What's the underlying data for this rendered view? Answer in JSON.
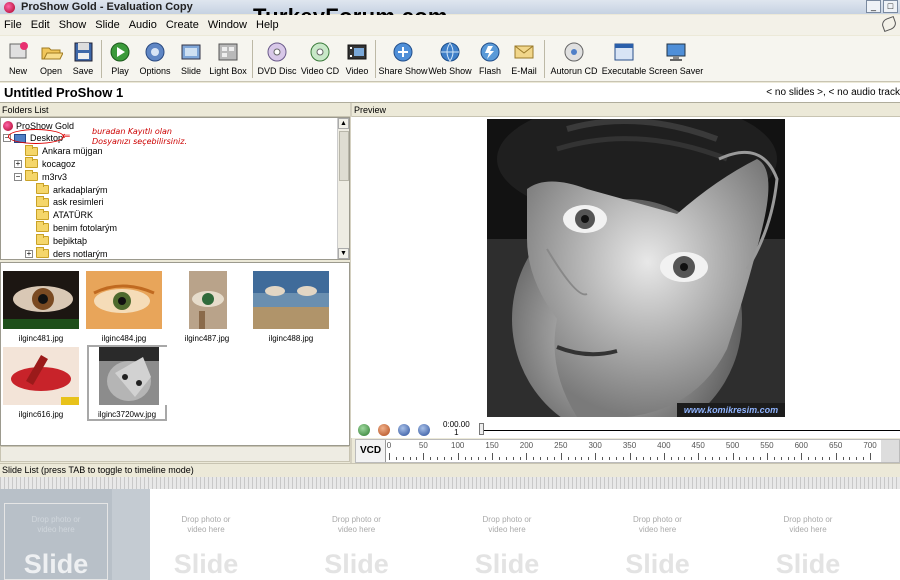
{
  "window": {
    "title": "ProShow Gold - Evaluation Copy",
    "min": "_",
    "max": "□"
  },
  "watermark": "TurkeyForum.com",
  "menu": [
    "File",
    "Edit",
    "Show",
    "Slide",
    "Audio",
    "Create",
    "Window",
    "Help"
  ],
  "toolbar": [
    {
      "label": "New",
      "icon": "new-icon"
    },
    {
      "label": "Open",
      "icon": "open-icon"
    },
    {
      "label": "Save",
      "icon": "save-icon"
    },
    {
      "label": "Play",
      "icon": "play-icon"
    },
    {
      "label": "Options",
      "icon": "options-icon"
    },
    {
      "label": "Slide",
      "icon": "slide-icon"
    },
    {
      "label": "Light Box",
      "icon": "lightbox-icon"
    },
    {
      "label": "DVD Disc",
      "icon": "dvd-icon"
    },
    {
      "label": "Video CD",
      "icon": "videocd-icon"
    },
    {
      "label": "Video",
      "icon": "video-icon"
    },
    {
      "label": "Share Show",
      "icon": "share-icon"
    },
    {
      "label": "Web Show",
      "icon": "web-icon"
    },
    {
      "label": "Flash",
      "icon": "flash-icon"
    },
    {
      "label": "E-Mail",
      "icon": "email-icon"
    },
    {
      "label": "Autorun CD",
      "icon": "autorun-icon"
    },
    {
      "label": "Executable",
      "icon": "executable-icon"
    },
    {
      "label": "Screen Saver",
      "icon": "screensaver-icon"
    }
  ],
  "project": {
    "title": "Untitled ProShow 1",
    "status": "< no slides >, < no audio track"
  },
  "folders": {
    "header": "Folders List",
    "items": [
      {
        "label": "ProShow Gold",
        "depth": 0,
        "kind": "root",
        "expander": ""
      },
      {
        "label": "Desktop",
        "depth": 0,
        "kind": "desktop",
        "expander": "−"
      },
      {
        "label": "Ankara müjgan",
        "depth": 1,
        "kind": "folder",
        "expander": ""
      },
      {
        "label": "kocagoz",
        "depth": 1,
        "kind": "folder",
        "expander": "+"
      },
      {
        "label": "m3rv3",
        "depth": 1,
        "kind": "folder",
        "expander": "−"
      },
      {
        "label": "arkadaþlarým",
        "depth": 2,
        "kind": "folder",
        "expander": ""
      },
      {
        "label": "ask resimleri",
        "depth": 2,
        "kind": "folder",
        "expander": ""
      },
      {
        "label": "ATATÜRK",
        "depth": 2,
        "kind": "folder",
        "expander": ""
      },
      {
        "label": "benim fotolarým",
        "depth": 2,
        "kind": "folder",
        "expander": ""
      },
      {
        "label": "beþiktaþ",
        "depth": 2,
        "kind": "folder",
        "expander": ""
      },
      {
        "label": "ders notlarým",
        "depth": 2,
        "kind": "folder",
        "expander": "+"
      }
    ],
    "annotation_line1": "buradan Kayıtlı olan",
    "annotation_line2": "Dosyanızı seçebilirsiniz."
  },
  "thumbnails": [
    {
      "name": "ilginc481.jpg",
      "selected": false
    },
    {
      "name": "ilginc484.jpg",
      "selected": false
    },
    {
      "name": "ilginc487.jpg",
      "selected": false
    },
    {
      "name": "ilginc488.jpg",
      "selected": false
    },
    {
      "name": "ilginc616.jpg",
      "selected": false
    },
    {
      "name": "ilginc3720wv.jpg",
      "selected": true
    }
  ],
  "preview": {
    "header": "Preview",
    "credit": "www.komikresim.com"
  },
  "transport": {
    "time": "0:00.00",
    "sub": "1"
  },
  "timeline": {
    "format": "VCD",
    "ticks": [
      "0",
      "50",
      "100",
      "150",
      "200",
      "250",
      "300",
      "350",
      "400",
      "450",
      "500",
      "550",
      "600",
      "650",
      "700"
    ]
  },
  "slide_list": {
    "header": "Slide List (press TAB to toggle to timeline mode)",
    "slots": [
      {
        "drop": "Drop photo or video here",
        "label": "Slide"
      },
      {
        "drop": "Drop photo or video here",
        "label": "Slide"
      },
      {
        "drop": "Drop photo or video here",
        "label": "Slide"
      },
      {
        "drop": "Drop photo or video here",
        "label": "Slide"
      },
      {
        "drop": "Drop photo or video here",
        "label": "Slide"
      },
      {
        "drop": "Drop photo or video here",
        "label": "Slide"
      }
    ]
  }
}
